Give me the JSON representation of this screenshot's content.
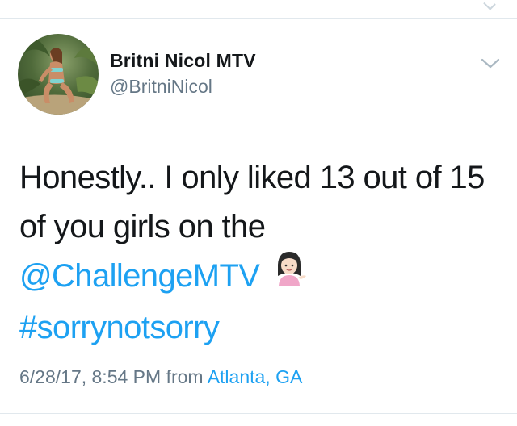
{
  "tweet": {
    "author": {
      "name": "Britni Nicol MTV",
      "handle": "@BritniNicol"
    },
    "text": {
      "line1": "Honestly.. I only liked 13 out of 15",
      "line2": "of you girls on the",
      "mention": "@ChallengeMTV",
      "hashtag": "#sorrynotsorry"
    },
    "emoji_icon": "information-desk-person-emoji",
    "timestamp": "6/28/17, 8:54 PM",
    "from_label": "from",
    "location": "Atlanta, GA"
  },
  "colors": {
    "link": "#1da1f2",
    "secondary_text": "#657786",
    "primary_text": "#14171a",
    "divider": "#e1e8ed"
  }
}
